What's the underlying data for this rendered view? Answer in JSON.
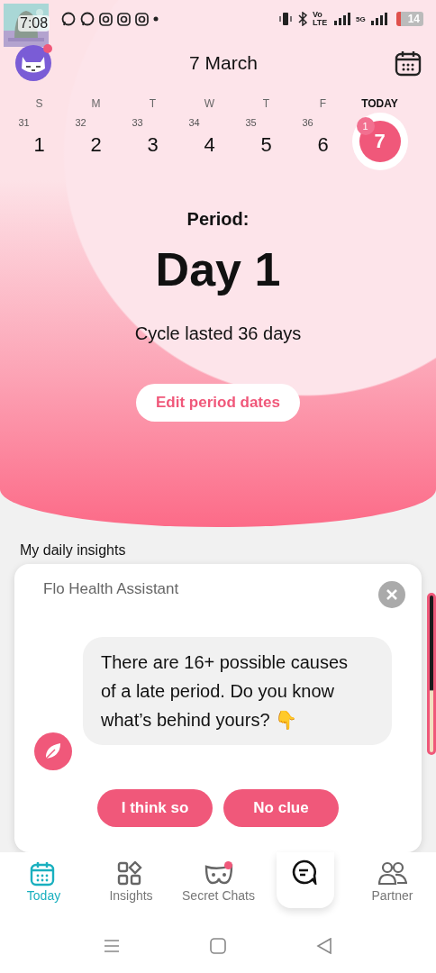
{
  "status_bar": {
    "time": "7:08",
    "network_label": "Vo LTE",
    "signal_label": "5G",
    "battery": "14"
  },
  "header": {
    "title": "7 March",
    "avatar_notification": true
  },
  "week": [
    {
      "weekday": "S",
      "cycle_day": "31",
      "date": "1",
      "selected": false
    },
    {
      "weekday": "M",
      "cycle_day": "32",
      "date": "2",
      "selected": false
    },
    {
      "weekday": "T",
      "cycle_day": "33",
      "date": "3",
      "selected": false
    },
    {
      "weekday": "W",
      "cycle_day": "34",
      "date": "4",
      "selected": false
    },
    {
      "weekday": "T",
      "cycle_day": "35",
      "date": "5",
      "selected": false
    },
    {
      "weekday": "F",
      "cycle_day": "36",
      "date": "6",
      "selected": false
    },
    {
      "weekday": "TODAY",
      "cycle_day": "1",
      "date": "7",
      "selected": true
    }
  ],
  "period": {
    "label": "Period:",
    "day": "Day 1",
    "note": "Cycle lasted 36 days",
    "button": "Edit period dates"
  },
  "insights": {
    "heading": "My daily insights"
  },
  "assistant": {
    "title": "Flo Health Assistant",
    "message": "There are 16+ possible causes of a late period. Do you know what’s behind yours? 👇",
    "answers": [
      "I think so",
      "No clue"
    ]
  },
  "bottom_nav": [
    {
      "label": "Today",
      "selected": true,
      "notification": false
    },
    {
      "label": "Insights",
      "selected": false,
      "notification": false
    },
    {
      "label": "Secret Chats",
      "selected": false,
      "notification": true
    },
    {
      "selected": false,
      "notification": false
    },
    {
      "label": "Partner",
      "selected": false,
      "notification": false
    }
  ]
}
